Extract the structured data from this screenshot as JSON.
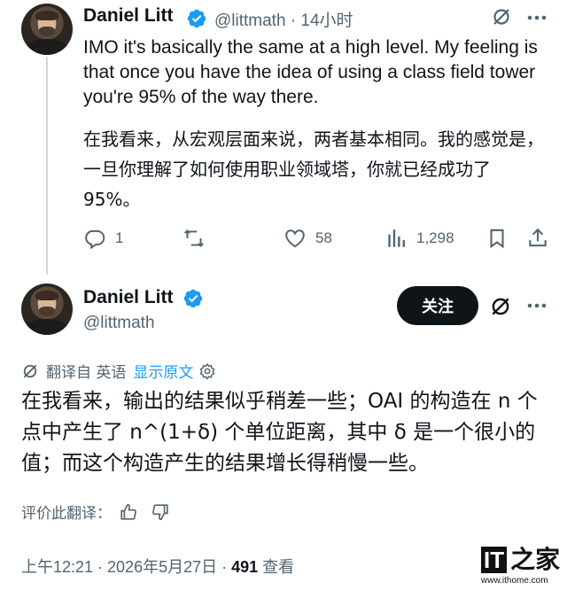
{
  "tweet1": {
    "author_name": "Daniel Litt",
    "handle": "@littmath",
    "separator": "·",
    "time": "14小时",
    "text_en": "IMO it's basically the same at a high level. My feeling is that once you have the idea of using a class field tower you're 95% of the way there.",
    "text_zh": "在我看来，从宏观层面来说，两者基本相同。我的感觉是，一旦你理解了如何使用职业领域塔，你就已经成功了95%。",
    "actions": {
      "reply_count": "1",
      "retweet_count": "",
      "like_count": "58",
      "views_count": "1,298"
    }
  },
  "tweet2": {
    "author_name": "Daniel Litt",
    "handle": "@littmath",
    "follow_label": "关注",
    "translated_from": "翻译自 英语",
    "show_original": "显示原文",
    "text": "在我看来，输出的结果似乎稍差一些；OAI 的构造在 n 个点中产生了 n^(1+δ) 个单位距离，其中 δ 是一个很小的值；而这个构造产生的结果增长得稍慢一些。",
    "rate_translation": "评价此翻译：",
    "footer_time": "上午12:21 · 2026年5月27日 · ",
    "footer_views": "491",
    "footer_views_label": " 查看"
  },
  "watermark": {
    "logo_it": "IT",
    "logo_zh": "之家",
    "url": "www.ithome.com"
  },
  "colors": {
    "text": "#0f1419",
    "secondary": "#536471",
    "accent": "#1d9bf0",
    "verified": "#1d9bf0"
  }
}
